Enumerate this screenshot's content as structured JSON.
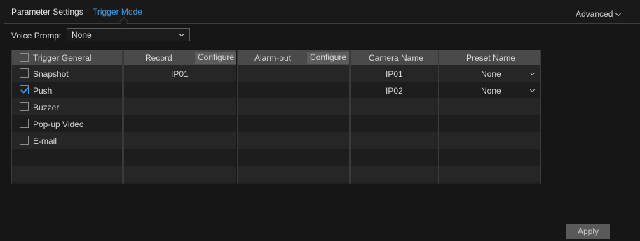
{
  "tabs": [
    {
      "label": "Parameter Settings",
      "active": false
    },
    {
      "label": "Trigger Mode",
      "active": true
    }
  ],
  "advanced_label": "Advanced",
  "voice_prompt": {
    "label": "Voice Prompt",
    "value": "None"
  },
  "trigger_general": {
    "header": "Trigger General",
    "items": [
      {
        "label": "Snapshot",
        "checked": false
      },
      {
        "label": "Push",
        "checked": true
      },
      {
        "label": "Buzzer",
        "checked": false
      },
      {
        "label": "Pop-up Video",
        "checked": false
      },
      {
        "label": "E-mail",
        "checked": false
      }
    ]
  },
  "record": {
    "header": "Record",
    "configure_label": "Configure",
    "rows": [
      "IP01"
    ]
  },
  "alarm_out": {
    "header": "Alarm-out",
    "configure_label": "Configure",
    "rows": []
  },
  "preset": {
    "camera_header": "Camera Name",
    "preset_header": "Preset Name",
    "rows": [
      {
        "camera": "IP01",
        "preset": "None"
      },
      {
        "camera": "IP02",
        "preset": "None"
      }
    ]
  },
  "apply_label": "Apply",
  "colors": {
    "accent": "#3d9be9",
    "background": "#161616",
    "header": "#4a4a4a"
  }
}
